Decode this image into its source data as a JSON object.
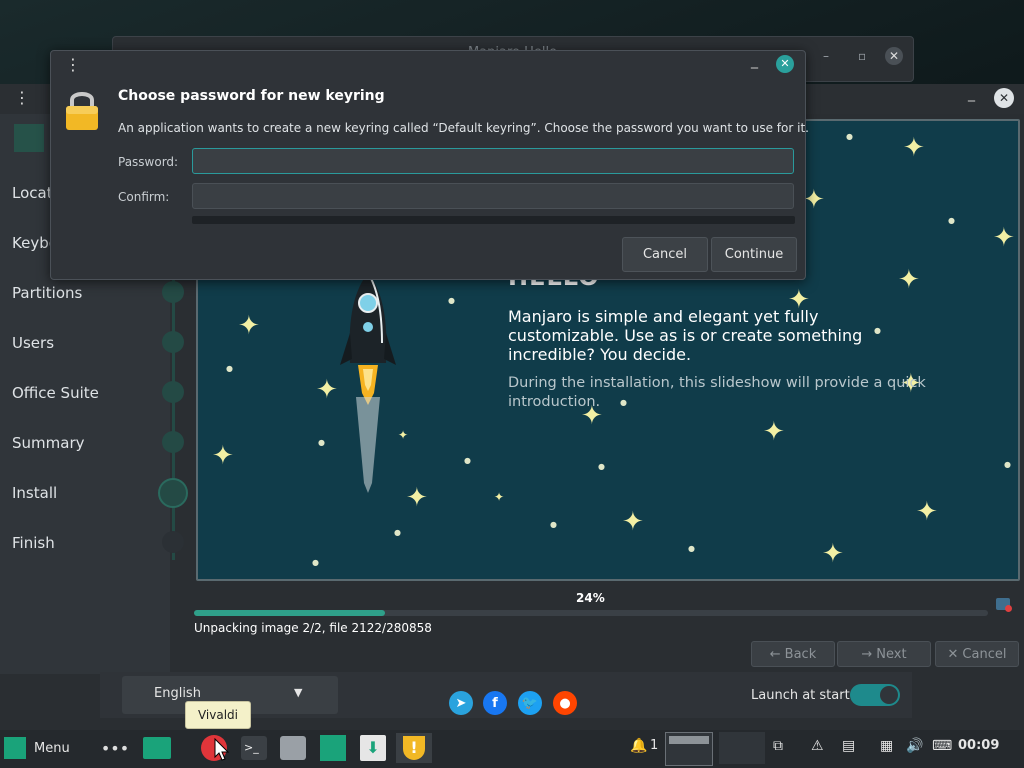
{
  "background_window": {
    "title": "Manjaro Hello"
  },
  "installer": {
    "sidebar": {
      "items": [
        {
          "label": "Locat"
        },
        {
          "label": "Keybo"
        },
        {
          "label": "Partitions"
        },
        {
          "label": "Users"
        },
        {
          "label": "Office Suite"
        },
        {
          "label": "Summary"
        },
        {
          "label": "Install"
        },
        {
          "label": "Finish"
        }
      ]
    },
    "slideshow": {
      "heading": "HELLO",
      "text1": "Manjaro is simple and elegant yet fully customizable. Use as is or create something incredible? You decide.",
      "text2": "During the installation, this slideshow will provide a quick introduction."
    },
    "progress": {
      "percent_label": "24%",
      "fraction": 0.24,
      "status": "Unpacking image 2/2, file 2122/280858"
    },
    "nav": {
      "back": "Back",
      "next": "Next",
      "cancel": "Cancel"
    },
    "bottom": {
      "language": "English",
      "launch_label": "Launch at start",
      "launch_enabled": true
    }
  },
  "dialog": {
    "title": "Choose password for new keyring",
    "description": "An application wants to create a new keyring called “Default keyring”. Choose the password you want to use for it.",
    "password_label": "Password:",
    "confirm_label": "Confirm:",
    "password_value": "",
    "confirm_value": "",
    "cancel": "Cancel",
    "continue": "Continue"
  },
  "tooltip": {
    "text": "Vivaldi"
  },
  "taskbar": {
    "menu_label": "Menu",
    "workspace_count": "1",
    "clock": "00:09"
  },
  "colors": {
    "accent": "#2fa08a",
    "slide_bg": "#103c4a",
    "star": "#f3f0a4"
  }
}
